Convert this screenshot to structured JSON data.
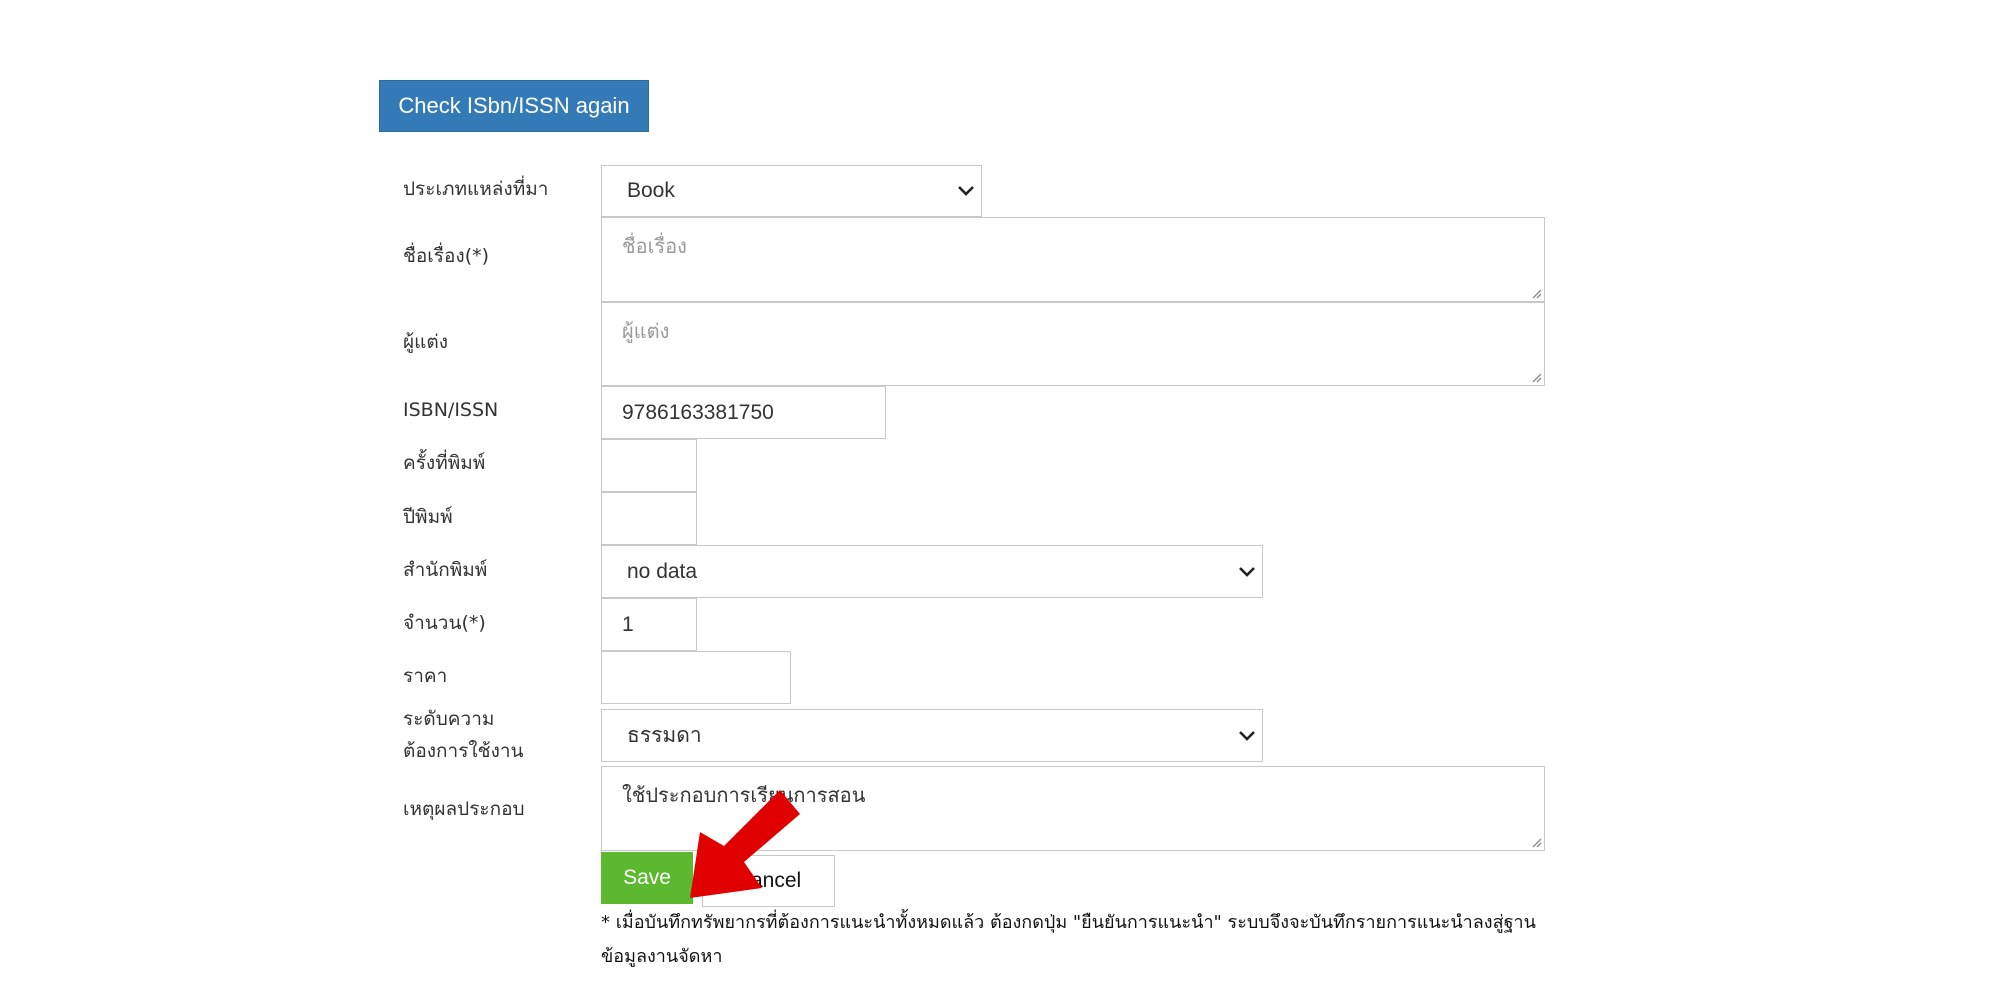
{
  "toolbar": {
    "check_button_label": "Check ISbn/ISSN again"
  },
  "form": {
    "source_type": {
      "label": "ประเภทแหล่งที่มา",
      "value": "Book"
    },
    "title": {
      "label": "ชื่อเรื่อง(*)",
      "placeholder": "ชื่อเรื่อง",
      "value": ""
    },
    "author": {
      "label": "ผู้แต่ง",
      "placeholder": "ผู้แต่ง",
      "value": ""
    },
    "isbn": {
      "label": "ISBN/ISSN",
      "value": "9786163381750"
    },
    "edition": {
      "label": "ครั้งที่พิมพ์",
      "value": ""
    },
    "year": {
      "label": "ปีพิมพ์",
      "value": ""
    },
    "publisher": {
      "label": "สำนักพิมพ์",
      "value": "no data"
    },
    "quantity": {
      "label": "จำนวน(*)",
      "value": "1"
    },
    "price": {
      "label": "ราคา",
      "value": ""
    },
    "priority": {
      "label_line1": "ระดับความ",
      "label_line2": "ต้องการใช้งาน",
      "value": "ธรรมดา"
    },
    "reason": {
      "label": "เหตุผลประกอบ",
      "value": "ใช้ประกอบการเรียนการสอน"
    }
  },
  "actions": {
    "save_label": "Save",
    "cancel_label": "Cancel"
  },
  "note": "* เมื่อบันทึกทรัพยากรที่ต้องการแนะนำทั้งหมดแล้ว ต้องกดปุ่ม \"ยืนยันการแนะนำ\" ระบบจึงจะบันทึกรายการแนะนำลงสู่ฐานข้อมูลงานจัดหา",
  "colors": {
    "primary": "#337ab7",
    "success": "#5cb82e",
    "annotation_arrow": "#e00000"
  },
  "icons": {
    "select_chevron": "chevron-down-icon",
    "resize_grip": "resize-grip-icon",
    "annotation": "red-arrow-pointer"
  }
}
